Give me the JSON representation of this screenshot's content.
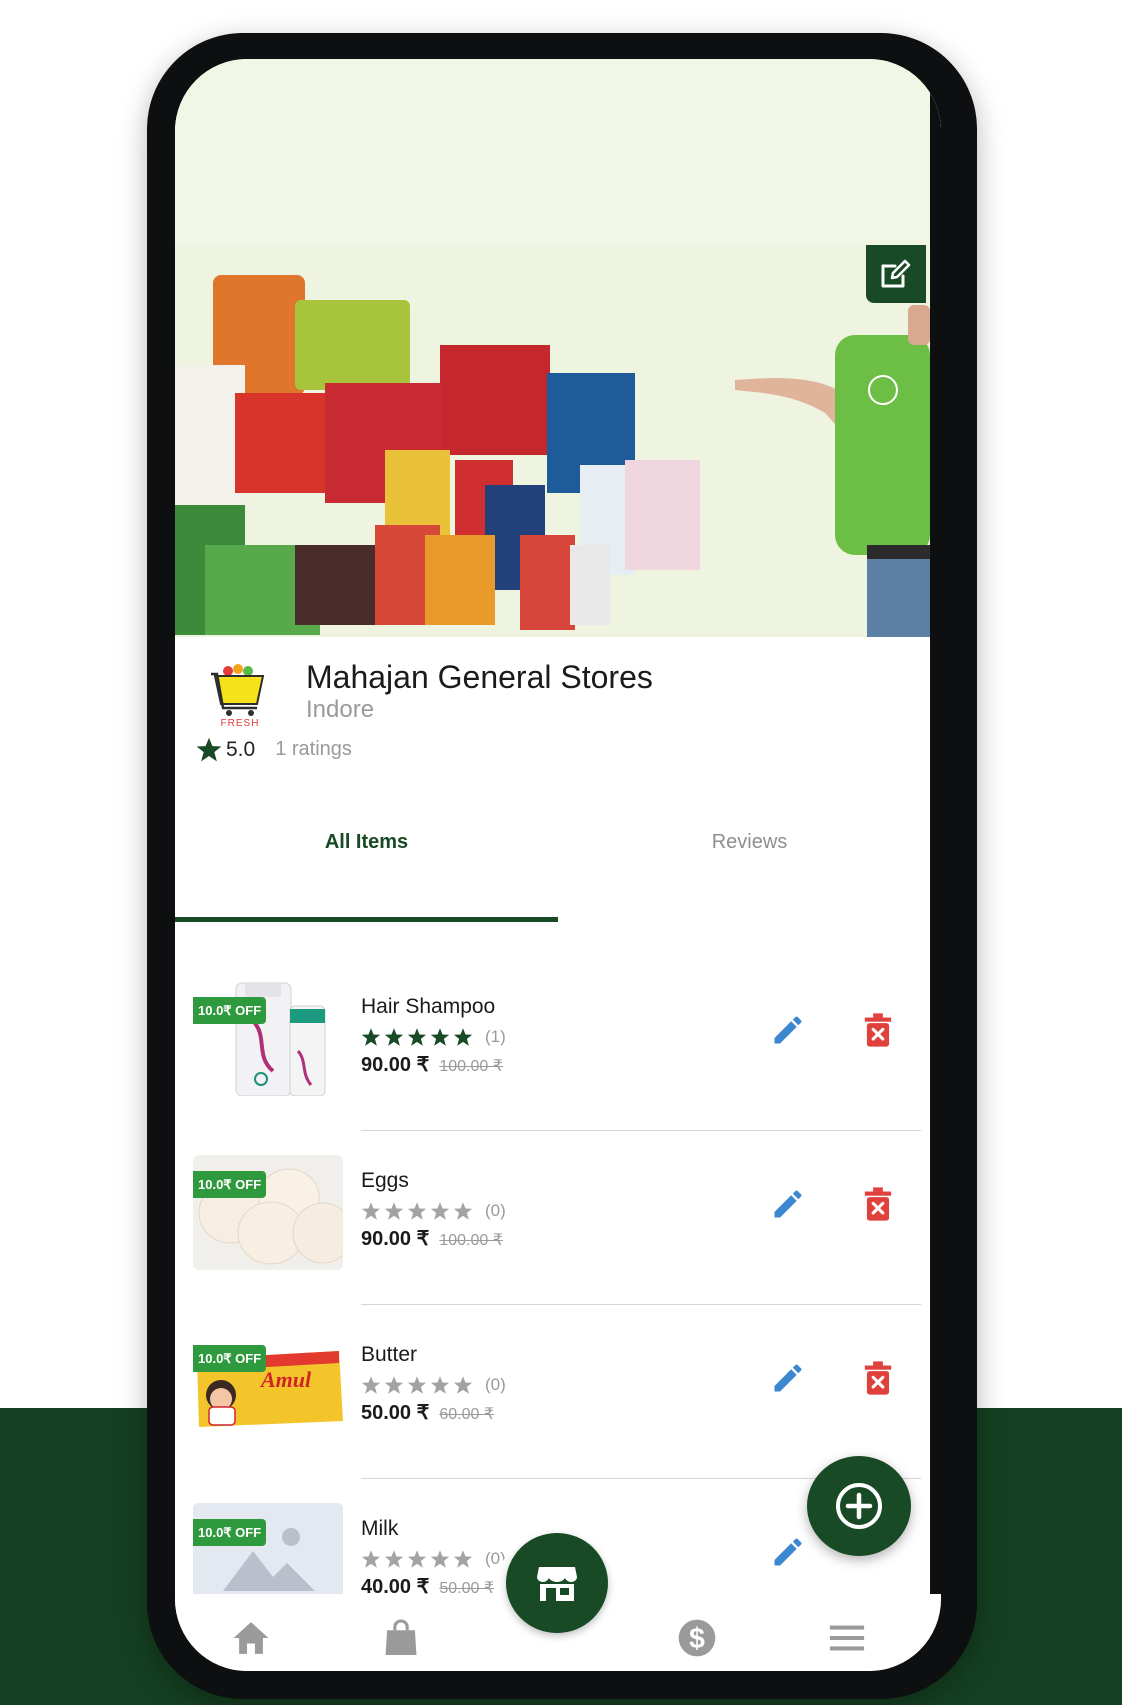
{
  "store": {
    "name": "Mahajan General Stores",
    "city": "Indore",
    "rating": "5.0",
    "ratings_count": "1 ratings",
    "logo_text": "FRESH"
  },
  "tabs": [
    {
      "label": "All Items",
      "active": true
    },
    {
      "label": "Reviews",
      "active": false
    }
  ],
  "items": [
    {
      "name": "Hair Shampoo",
      "discount": "10.0₹ OFF",
      "rating": 5,
      "reviews": "(1)",
      "price": "90.00 ₹",
      "old_price": "100.00 ₹",
      "thumb": "shampoo-bottles"
    },
    {
      "name": "Eggs",
      "discount": "10.0₹ OFF",
      "rating": 0,
      "reviews": "(0)",
      "price": "90.00 ₹",
      "old_price": "100.00 ₹",
      "thumb": "eggs"
    },
    {
      "name": "Butter",
      "discount": "10.0₹ OFF",
      "rating": 0,
      "reviews": "(0)",
      "price": "50.00 ₹",
      "old_price": "60.00 ₹",
      "thumb": "butter-pack"
    },
    {
      "name": "Milk",
      "discount": "10.0₹ OFF",
      "rating": 0,
      "reviews": "(0)",
      "price": "40.00 ₹",
      "old_price": "50.00 ₹",
      "thumb": "image-placeholder"
    }
  ],
  "nav": [
    "home-icon",
    "bag-icon",
    "store-icon",
    "dollar-icon",
    "menu-icon"
  ],
  "colors": {
    "primary": "#174a25",
    "badge": "#2e9a3d",
    "edit": "#3d87d0",
    "delete": "#e0413b",
    "band": "#153f20"
  }
}
